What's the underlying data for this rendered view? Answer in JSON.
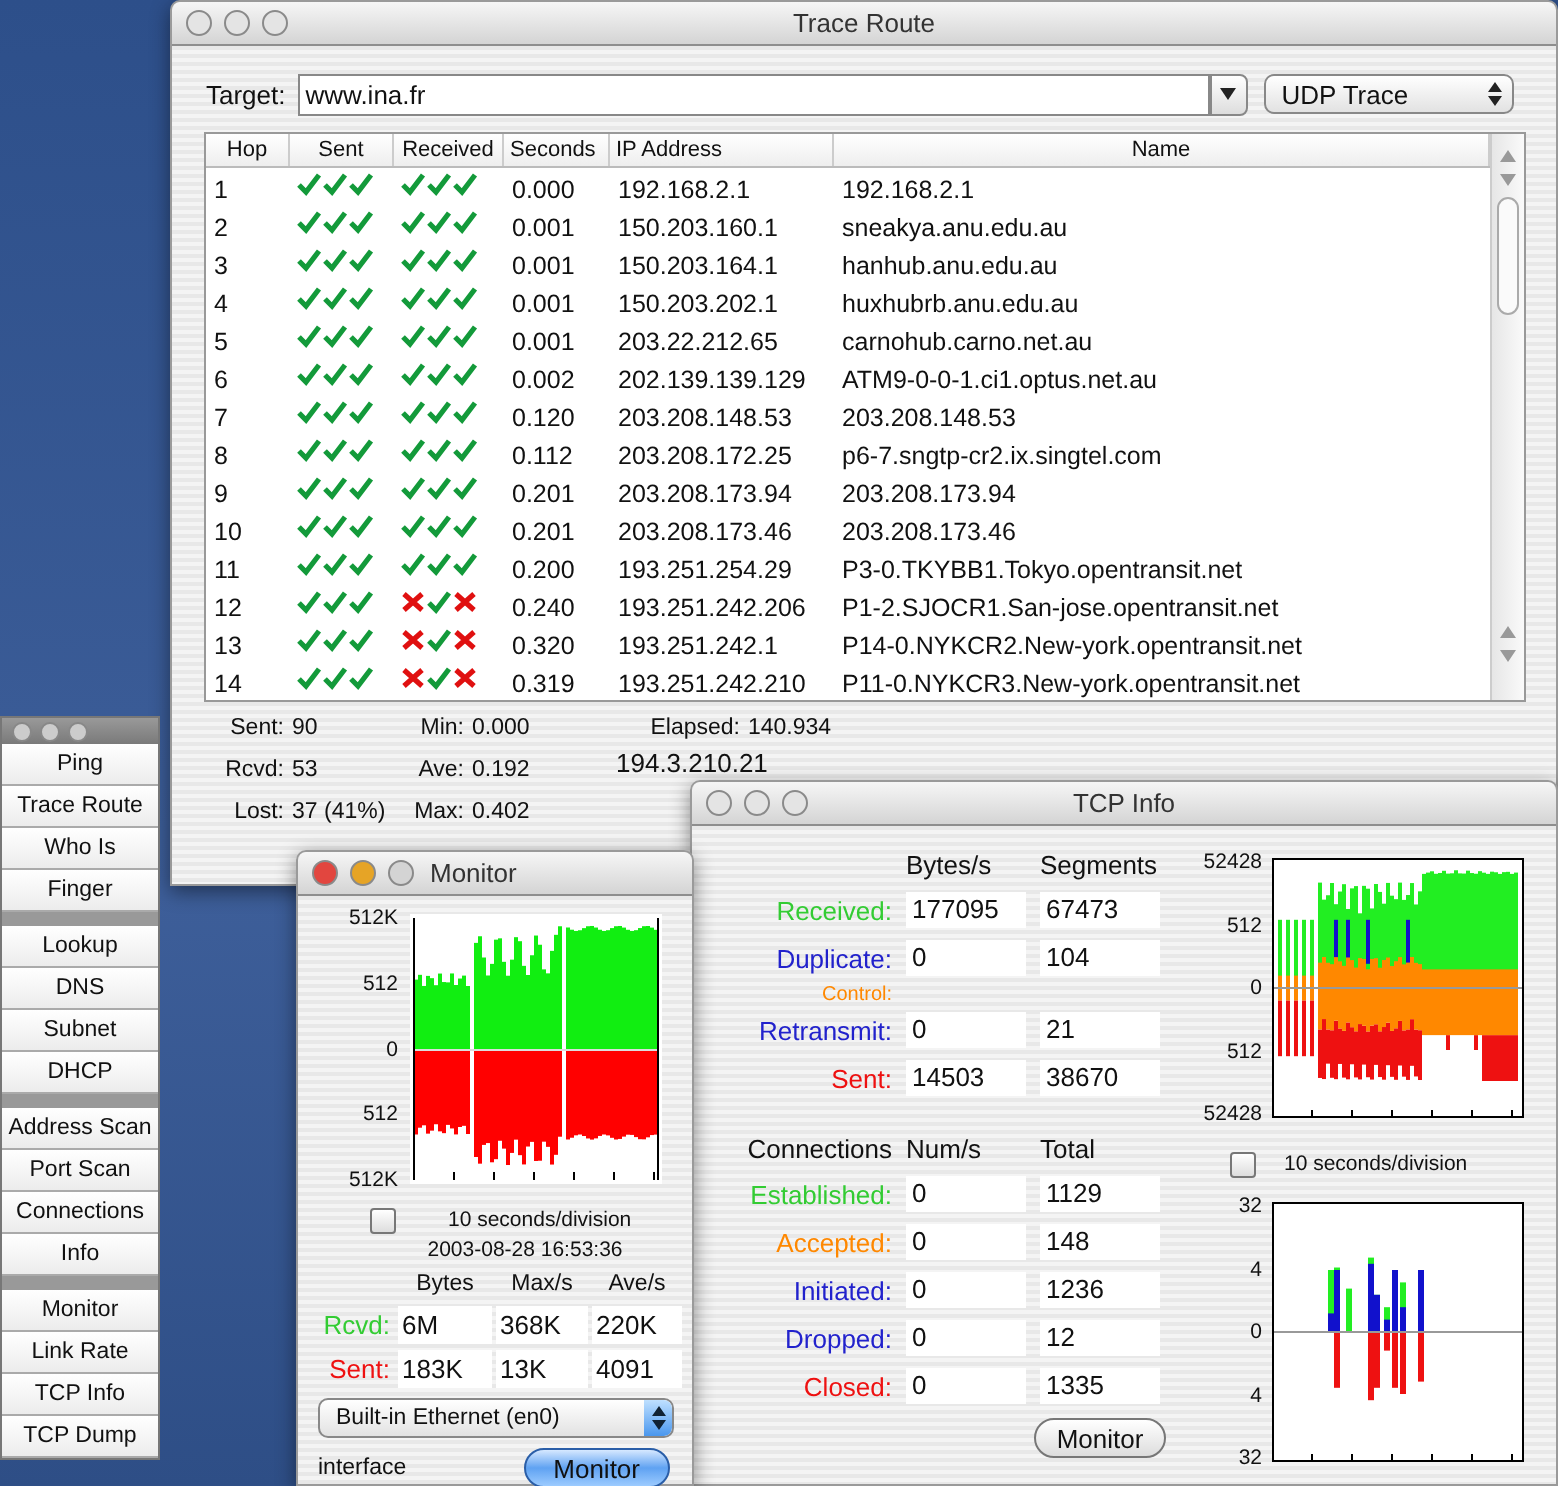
{
  "trace_window": {
    "title": "Trace Route",
    "focused": false,
    "target_label": "Target:",
    "target": "www.ina.fr",
    "mode": "UDP Trace",
    "columns": [
      "Hop",
      "Sent",
      "Received",
      "Seconds",
      "IP Address",
      "Name"
    ],
    "rows": [
      {
        "hop": "1",
        "sent": [
          true,
          true,
          true
        ],
        "received": [
          true,
          true,
          true
        ],
        "seconds": "0.000",
        "ip": "192.168.2.1",
        "name": "192.168.2.1"
      },
      {
        "hop": "2",
        "sent": [
          true,
          true,
          true
        ],
        "received": [
          true,
          true,
          true
        ],
        "seconds": "0.001",
        "ip": "150.203.160.1",
        "name": "sneakya.anu.edu.au"
      },
      {
        "hop": "3",
        "sent": [
          true,
          true,
          true
        ],
        "received": [
          true,
          true,
          true
        ],
        "seconds": "0.001",
        "ip": "150.203.164.1",
        "name": "hanhub.anu.edu.au"
      },
      {
        "hop": "4",
        "sent": [
          true,
          true,
          true
        ],
        "received": [
          true,
          true,
          true
        ],
        "seconds": "0.001",
        "ip": "150.203.202.1",
        "name": "huxhubrb.anu.edu.au"
      },
      {
        "hop": "5",
        "sent": [
          true,
          true,
          true
        ],
        "received": [
          true,
          true,
          true
        ],
        "seconds": "0.001",
        "ip": "203.22.212.65",
        "name": "carnohub.carno.net.au"
      },
      {
        "hop": "6",
        "sent": [
          true,
          true,
          true
        ],
        "received": [
          true,
          true,
          true
        ],
        "seconds": "0.002",
        "ip": "202.139.139.129",
        "name": "ATM9-0-0-1.ci1.optus.net.au"
      },
      {
        "hop": "7",
        "sent": [
          true,
          true,
          true
        ],
        "received": [
          true,
          true,
          true
        ],
        "seconds": "0.120",
        "ip": "203.208.148.53",
        "name": "203.208.148.53"
      },
      {
        "hop": "8",
        "sent": [
          true,
          true,
          true
        ],
        "received": [
          true,
          true,
          true
        ],
        "seconds": "0.112",
        "ip": "203.208.172.25",
        "name": "p6-7.sngtp-cr2.ix.singtel.com"
      },
      {
        "hop": "9",
        "sent": [
          true,
          true,
          true
        ],
        "received": [
          true,
          true,
          true
        ],
        "seconds": "0.201",
        "ip": "203.208.173.94",
        "name": "203.208.173.94"
      },
      {
        "hop": "10",
        "sent": [
          true,
          true,
          true
        ],
        "received": [
          true,
          true,
          true
        ],
        "seconds": "0.201",
        "ip": "203.208.173.46",
        "name": "203.208.173.46"
      },
      {
        "hop": "11",
        "sent": [
          true,
          true,
          true
        ],
        "received": [
          true,
          true,
          true
        ],
        "seconds": "0.200",
        "ip": "193.251.254.29",
        "name": "P3-0.TKYBB1.Tokyo.opentransit.net"
      },
      {
        "hop": "12",
        "sent": [
          true,
          true,
          true
        ],
        "received": [
          false,
          true,
          false
        ],
        "seconds": "0.240",
        "ip": "193.251.242.206",
        "name": "P1-2.SJOCR1.San-jose.opentransit.net"
      },
      {
        "hop": "13",
        "sent": [
          true,
          true,
          true
        ],
        "received": [
          false,
          true,
          false
        ],
        "seconds": "0.320",
        "ip": "193.251.242.1",
        "name": "P14-0.NYKCR2.New-york.opentransit.net"
      },
      {
        "hop": "14",
        "sent": [
          true,
          true,
          true
        ],
        "received": [
          false,
          true,
          false
        ],
        "seconds": "0.319",
        "ip": "193.251.242.210",
        "name": "P11-0.NYKCR3.New-york.opentransit.net"
      }
    ],
    "stats": [
      [
        {
          "label": "Sent:",
          "value": "90"
        },
        {
          "label": "Min:",
          "value": "0.000"
        },
        {
          "label": "Elapsed:",
          "value": "140.934"
        }
      ],
      [
        {
          "label": "Rcvd:",
          "value": "53"
        },
        {
          "label": "Ave:",
          "value": "0.192"
        }
      ],
      [
        {
          "label": "Lost:",
          "value": "37 (41%)"
        },
        {
          "label": "Max:",
          "value": "0.402"
        }
      ]
    ],
    "current_address": "194.3.210.21"
  },
  "tool_palette": {
    "groups": [
      [
        "Ping",
        "Trace Route",
        "Who Is",
        "Finger"
      ],
      [
        "Lookup",
        "DNS",
        "Subnet",
        "DHCP"
      ],
      [
        "Address Scan",
        "Port Scan",
        "Connections",
        "Info"
      ],
      [
        "Monitor",
        "Link Rate",
        "TCP Info",
        "TCP Dump"
      ]
    ]
  },
  "monitor_window": {
    "title": "Monitor",
    "focused": true,
    "y_labels": [
      "512K",
      "512",
      "0",
      "512",
      "512K"
    ],
    "scale_checked": false,
    "scale_label": "10 seconds/division",
    "timestamp": "2003-08-28 16:53:36",
    "columns": [
      "Bytes",
      "Max/s",
      "Ave/s"
    ],
    "rows": [
      {
        "label": "Rcvd:",
        "color": "#33cc33",
        "values": [
          "6M",
          "368K",
          "220K"
        ]
      },
      {
        "label": "Sent:",
        "color": "#ee1111",
        "values": [
          "183K",
          "13K",
          "4091"
        ]
      }
    ],
    "interface": "Built-in Ethernet (en0)",
    "interface_label": "interface",
    "button": "Monitor",
    "button_default": true
  },
  "tcp_window": {
    "title": "TCP Info",
    "focused": false,
    "segment_columns": [
      "Bytes/s",
      "Segments"
    ],
    "segment_rows": [
      {
        "kind": "row",
        "label": "Received:",
        "color": "#33cc33",
        "values": [
          "177095",
          "67473"
        ]
      },
      {
        "kind": "row",
        "label": "Duplicate:",
        "color": "#2222cc",
        "values": [
          "0",
          "104"
        ]
      },
      {
        "kind": "caption",
        "label": "Control:",
        "color": "#ff8800"
      },
      {
        "kind": "row",
        "label": "Retransmit:",
        "color": "#2222cc",
        "values": [
          "0",
          "21"
        ]
      },
      {
        "kind": "row",
        "label": "Sent:",
        "color": "#ee1111",
        "values": [
          "14503",
          "38670"
        ]
      }
    ],
    "connection_columns": [
      "Connections",
      "Num/s",
      "Total"
    ],
    "connection_rows": [
      {
        "label": "Established:",
        "color": "#33cc33",
        "values": [
          "0",
          "1129"
        ]
      },
      {
        "label": "Accepted:",
        "color": "#ff8800",
        "values": [
          "0",
          "148"
        ]
      },
      {
        "label": "Initiated:",
        "color": "#2222cc",
        "values": [
          "0",
          "1236"
        ]
      },
      {
        "label": "Dropped:",
        "color": "#2222cc",
        "values": [
          "0",
          "12"
        ]
      },
      {
        "label": "Closed:",
        "color": "#ee1111",
        "values": [
          "0",
          "1335"
        ]
      }
    ],
    "button": "Monitor",
    "button_default": false,
    "segment_y_labels": [
      "52428",
      "512",
      "0",
      "512",
      "52428"
    ],
    "scale_checked": false,
    "scale_label": "10 seconds/division",
    "connection_y_labels": [
      "32",
      "4",
      "0",
      "4",
      "32"
    ]
  }
}
